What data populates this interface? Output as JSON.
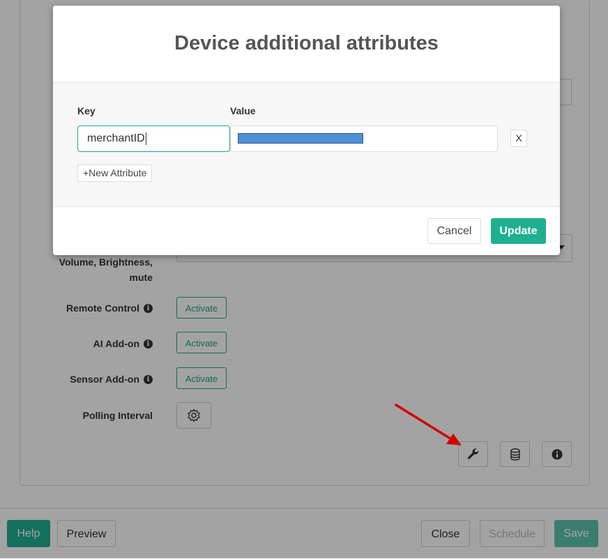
{
  "modal": {
    "title": "Device additional attributes",
    "key_header": "Key",
    "value_header": "Value",
    "attributes": [
      {
        "key": "merchantID",
        "value_redacted": true
      }
    ],
    "remove_label": "X",
    "new_attribute_label": "+New Attribute",
    "cancel_label": "Cancel",
    "update_label": "Update"
  },
  "settings": {
    "volume_label_line1": "Volume, Brightness,",
    "volume_label_line2": "mute",
    "remote_control_label": "Remote Control",
    "ai_addon_label": "AI Add-on",
    "sensor_addon_label": "Sensor Add-on",
    "polling_interval_label": "Polling Interval",
    "activate_label": "Activate"
  },
  "footer": {
    "help_label": "Help",
    "preview_label": "Preview",
    "close_label": "Close",
    "schedule_label": "Schedule",
    "save_label": "Save"
  },
  "colors": {
    "accent": "#1fb090",
    "annotation_arrow": "#d40000",
    "redaction": "#4f8fd4"
  },
  "icons": [
    "info-icon",
    "gear-icon",
    "wrench-icon",
    "database-icon",
    "info-circle-icon",
    "chevron-down-icon"
  ]
}
